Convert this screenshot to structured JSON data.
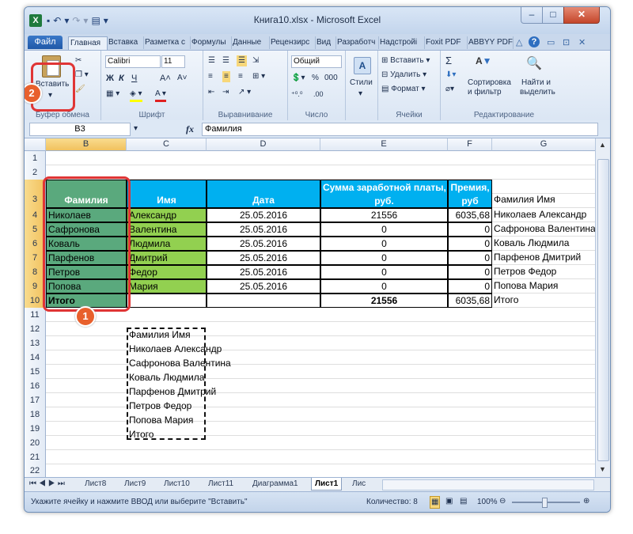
{
  "window": {
    "title": "Книга10.xlsx - Microsoft Excel",
    "app_icon": "X",
    "qat": [
      "▪",
      "↶",
      "▾",
      "↷",
      "▾",
      "▤",
      "▾"
    ],
    "controls": {
      "minimize": "–",
      "maximize": "□",
      "close": "✕"
    }
  },
  "ribbon_tabs": {
    "file": "Файл",
    "items": [
      "Главная",
      "Вставка",
      "Разметка с",
      "Формулы",
      "Данные",
      "Рецензирс",
      "Вид",
      "Разработч",
      "Надстройі",
      "Foxit PDF",
      "ABBYY PDF"
    ],
    "right_controls": [
      "△",
      "?",
      "▭",
      "⊡",
      "✕"
    ]
  },
  "ribbon": {
    "clipboard": {
      "paste_label": "Вставить",
      "group_label": "Буфер обмена"
    },
    "font": {
      "font_name": "Calibri",
      "font_size": "11",
      "bold": "Ж",
      "italic": "К",
      "underline": "Ч",
      "grow": "A˄",
      "shrink": "A˅",
      "group_label": "Шрифт"
    },
    "alignment": {
      "group_label": "Выравнивание"
    },
    "number": {
      "format": "Общий",
      "percent": "%",
      "thousands": "000",
      "inc": "⁺⁰.⁰",
      "dec": ".00",
      "group_label": "Число"
    },
    "styles": {
      "label": "Стили"
    },
    "cells": {
      "insert": "Вставить",
      "delete": "Удалить",
      "format": "Формат",
      "group_label": "Ячейки"
    },
    "editing": {
      "sigma": "Σ",
      "sort": "Сортировка\nи фильтр",
      "sort_line1": "Сортировка",
      "sort_line2": "и фильтр",
      "find_line1": "Найти и",
      "find_line2": "выделить",
      "group_label": "Редактирование"
    }
  },
  "formula_bar": {
    "name_box": "B3",
    "fx": "fx",
    "value": "Фамилия"
  },
  "columns": [
    "B",
    "C",
    "D",
    "E",
    "F",
    "G"
  ],
  "rows": [
    "1",
    "2",
    "3",
    "4",
    "5",
    "6",
    "7",
    "8",
    "9",
    "10",
    "11",
    "12",
    "13",
    "14",
    "15",
    "16",
    "17",
    "18",
    "19",
    "20",
    "21",
    "22"
  ],
  "table": {
    "headers": {
      "b": "Фамилия",
      "c": "Имя",
      "d": "Дата",
      "e1": "Сумма заработной платы,",
      "e2": "руб.",
      "f1": "Премия,",
      "f2": "руб",
      "g": "Фамилия Имя"
    },
    "rows": [
      {
        "b": "Николаев",
        "c": "Александр",
        "d": "25.05.2016",
        "e": "21556",
        "f": "6035,68",
        "g": "Николаев Александр"
      },
      {
        "b": "Сафронова",
        "c": "Валентина",
        "d": "25.05.2016",
        "e": "0",
        "f": "0",
        "g": "Сафронова Валентина"
      },
      {
        "b": "Коваль",
        "c": "Людмила",
        "d": "25.05.2016",
        "e": "0",
        "f": "0",
        "g": "Коваль Людмила"
      },
      {
        "b": "Парфенов",
        "c": "Дмитрий",
        "d": "25.05.2016",
        "e": "0",
        "f": "0",
        "g": "Парфенов Дмитрий"
      },
      {
        "b": "Петров",
        "c": "Федор",
        "d": "25.05.2016",
        "e": "0",
        "f": "0",
        "g": "Петров Федор"
      },
      {
        "b": "Попова",
        "c": "Мария",
        "d": "25.05.2016",
        "e": "0",
        "f": "0",
        "g": "Попова Мария"
      }
    ],
    "total": {
      "b": "Итого",
      "e": "21556",
      "f": "6035,68",
      "g": "Итого"
    }
  },
  "copied": [
    "Фамилия Имя",
    "Николаев Александр",
    "Сафронова Валентина",
    "Коваль Людмила",
    "Парфенов Дмитрий",
    "Петров Федор",
    "Попова Мария",
    "Итого"
  ],
  "badges": {
    "one": "1",
    "two": "2"
  },
  "sheet_tabs": [
    "Лист8",
    "Лист9",
    "Лист10",
    "Лист11",
    "Диаграмма1",
    "Лист1",
    "Лис"
  ],
  "status": {
    "message": "Укажите ячейку и нажмите ВВОД или выберите \"Вставить\"",
    "count": "Количество: 8",
    "zoom": "100%"
  },
  "colors": {
    "header_blue": "#00b0f0",
    "green": "#92d050",
    "selected_green": "#5aa97d",
    "highlight_red": "#e03535",
    "badge_orange": "#e8602c"
  }
}
